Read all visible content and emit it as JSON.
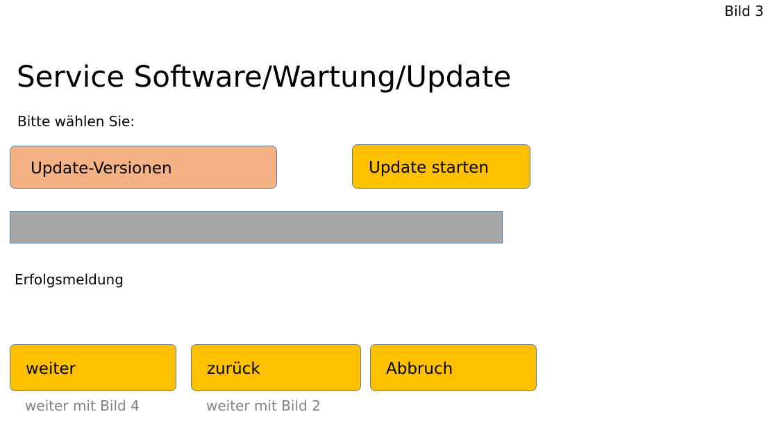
{
  "page_label": "Bild 3",
  "title": "Service Software/Wartung/Update",
  "prompt": "Bitte wählen Sie:",
  "buttons": {
    "update_versions": "Update-Versionen",
    "update_start": "Update starten",
    "next": "weiter",
    "back": "zurück",
    "cancel": "Abbruch"
  },
  "progress": {
    "value_fraction": 1.0
  },
  "status_message": "Erfolgsmeldung",
  "hints": {
    "next": "weiter mit Bild 4",
    "back": "weiter mit Bild 2"
  },
  "colors": {
    "primary_button": "#ffc000",
    "selected_button": "#f4b183",
    "progress_fill": "#a6a6a6",
    "button_border": "#5b7d9e",
    "hint_text": "#808080"
  }
}
